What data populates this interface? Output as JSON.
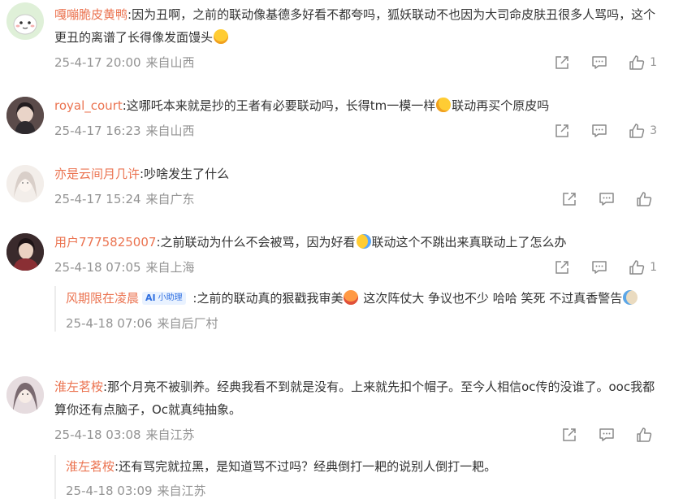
{
  "comments": [
    {
      "username": "嘎嘣脆皮黄鸭",
      "text_a": ":因为丑啊，之前的联动像基德多好看不都夸吗，狐妖联动不也因为大司命皮肤丑很多人骂吗，这个更丑的离谱了长得像发面馒头",
      "emoji_a": "laughing-tears",
      "time": "25-4-17 20:00",
      "location": "来自山西",
      "likes": "1"
    },
    {
      "username": "royal_court",
      "text_a": ":这哪吒本来就是抄的王者有必要联动吗，长得tm一模一样",
      "emoji_a": "sweat-smile",
      "text_b": "联动再买个原皮吗",
      "time": "25-4-17 16:23",
      "location": "来自山西",
      "likes": "3"
    },
    {
      "username": "亦是云间月几许",
      "text_a": ":吵啥发生了什么",
      "time": "25-4-17 15:24",
      "location": "来自广东",
      "likes": ""
    },
    {
      "username": "用户7775825007",
      "text_a": ":之前联动为什么不会被骂，因为好看",
      "emoji_a": "crying",
      "text_b": "联动这个不跳出来真联动上了怎么办",
      "time": "25-4-18 07:05",
      "location": "来自上海",
      "likes": "1",
      "reply": {
        "username": "风期限在凌晨",
        "badge_text": "小助理",
        "text_a": " :之前的联动真的狠戳我审美",
        "emoji_a": "heart-eyes",
        "text_b": " 这次阵仗大 争议也不少 哈哈 笑死 不过真香警告",
        "emoji_b": "doge",
        "time": "25-4-18 07:06",
        "location": "来自后厂村"
      }
    },
    {
      "username": "淮左茗桉",
      "text_a": ":那个月亮不被驯养。经典我看不到就是没有。上来就先扣个帽子。至今人相信oc传的没谁了。ooc我都算你还有点脑子，Oc就真纯抽象。",
      "time": "25-4-18 03:08",
      "location": "来自江苏",
      "likes": "",
      "reply": {
        "username": "淮左茗桉",
        "text_a": ":还有骂完就拉黑，是知道骂不过吗？经典倒打一耙的说别人倒打一耙。",
        "time": "25-4-18 03:09",
        "location": "来自江苏"
      }
    }
  ],
  "colors": {
    "username": "#eb7350",
    "meta": "#939393",
    "text": "#333333"
  },
  "icons": [
    "share-icon",
    "comment-icon",
    "like-icon"
  ]
}
